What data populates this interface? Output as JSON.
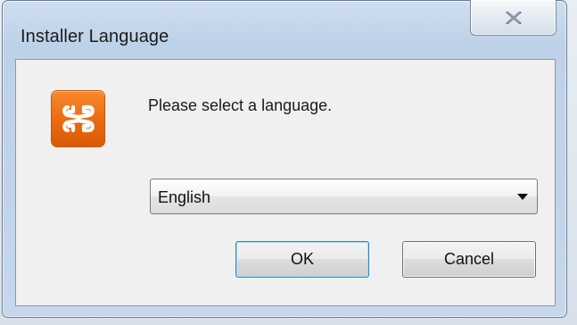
{
  "window": {
    "title": "Installer Language",
    "close_icon": "close-icon"
  },
  "dialog": {
    "app_icon": "xampp-logo-icon",
    "prompt": "Please select a language.",
    "language_select": {
      "selected": "English",
      "arrow_icon": "chevron-down-icon"
    },
    "ok_label": "OK",
    "cancel_label": "Cancel"
  },
  "colors": {
    "accent_orange": "#ea6a0f",
    "window_frame": "#bdd1e8",
    "client_bg": "#f0f0f0"
  }
}
